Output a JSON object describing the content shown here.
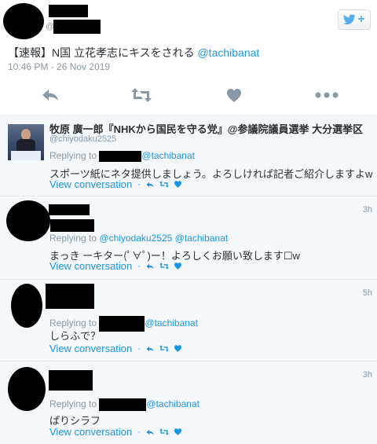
{
  "main_tweet": {
    "handle_fragment": "@",
    "text_prefix": "【速報】N国 立花孝志にキスをされる ",
    "text_mention": "@tachibanat",
    "timestamp": "10:46 PM - 26 Nov 2019",
    "follow_plus": "+"
  },
  "replies": [
    {
      "name": "牧原 廣一郎『NHKから国民を守る党』@参議院議員選挙 大分選挙区",
      "handle": "@chiyodaku2525",
      "time": "",
      "replying_label": "Replying to",
      "replying_mention": "@tachibanat",
      "body": "スポーツ紙にネタ提供しましょう。よろしければ記者ご紹介しますよw",
      "view_label": "View conversation"
    },
    {
      "name": "",
      "handle": "",
      "time": "3h",
      "replying_label": "Replying to",
      "replying_mention": "@chiyodaku2525 @tachibanat",
      "body": "まっき ーキター(ﾟ∀ﾟ)ー！よろしくお願い致します☐w",
      "view_label": "View conversation"
    },
    {
      "name": "",
      "handle": "",
      "time": "5h",
      "replying_label": "Replying to",
      "replying_mention": "@tachibanat",
      "body": "しらふで？",
      "view_label": "View conversation"
    },
    {
      "name": "",
      "handle": "",
      "time": "3h",
      "replying_label": "Replying to",
      "replying_mention": "@tachibanat",
      "body": "ぱりシラフ",
      "view_label": "View conversation"
    }
  ],
  "icons": {
    "reply": "reply-icon",
    "retweet": "retweet-icon",
    "like": "heart-icon",
    "more": "more-icon",
    "follow": "twitter-bird-icon"
  },
  "colors": {
    "accent": "#1b95e0",
    "muted": "#8899a6",
    "reply_bg": "#f5f8fa"
  }
}
